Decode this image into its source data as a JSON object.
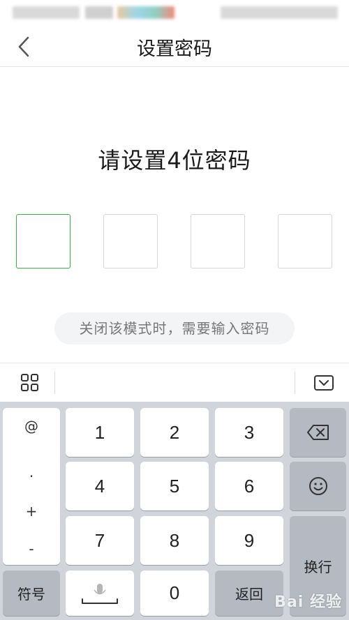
{
  "header": {
    "title": "设置密码"
  },
  "main": {
    "prompt": "请设置4位密码",
    "pin_boxes": [
      {
        "state": "active"
      },
      {
        "state": "empty"
      },
      {
        "state": "empty"
      },
      {
        "state": "empty"
      }
    ],
    "hint": "关闭该模式时，需要输入密码"
  },
  "keyboard": {
    "symbols": [
      "@",
      ".",
      "+",
      "-"
    ],
    "digits": [
      "1",
      "2",
      "3",
      "4",
      "5",
      "6",
      "7",
      "8",
      "9",
      "0"
    ],
    "enter_label": "换行",
    "symbol_label": "符号",
    "return_label": "返回"
  },
  "watermark": {
    "text": "Bai 经验"
  },
  "colors": {
    "active_border": "#3cb043",
    "keyboard_bg": "#d1d4da",
    "dark_key": "#b4b9c2"
  }
}
